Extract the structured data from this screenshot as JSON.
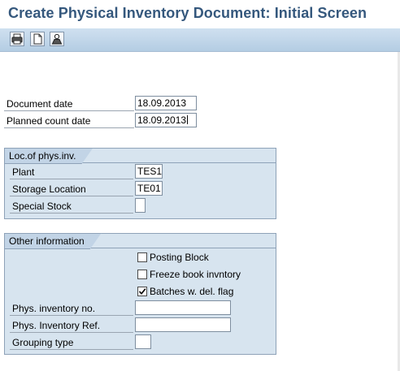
{
  "title": "Create Physical Inventory Document: Initial Screen",
  "toolbar": {
    "buttons": [
      {
        "icon": "print-icon"
      },
      {
        "icon": "new-document-icon"
      },
      {
        "icon": "profile-icon"
      }
    ]
  },
  "header": {
    "document_date": {
      "label": "Document date",
      "value": "18.09.2013"
    },
    "planned_count_date": {
      "label": "Planned count date",
      "value": "18.09.2013"
    }
  },
  "loc_group": {
    "title": "Loc.of phys.inv.",
    "plant": {
      "label": "Plant",
      "value": "TES1"
    },
    "storage_location": {
      "label": "Storage Location",
      "value": "TE01"
    },
    "special_stock": {
      "label": "Special Stock",
      "value": ""
    }
  },
  "other_group": {
    "title": "Other information",
    "posting_block": {
      "label": "Posting Block",
      "checked": false
    },
    "freeze_book": {
      "label": "Freeze book invntory",
      "checked": false
    },
    "batches_del_flag": {
      "label": "Batches w. del. flag",
      "checked": true
    },
    "phys_inventory_no": {
      "label": "Phys. inventory no.",
      "value": ""
    },
    "phys_inventory_ref": {
      "label": "Phys. Inventory Ref.",
      "value": ""
    },
    "grouping_type": {
      "label": "Grouping type",
      "value": ""
    }
  },
  "colors": {
    "title": "#35587d",
    "toolbar": "#c4d8ec",
    "group_bg": "#d7e4ef",
    "group_border": "#8ea2b8"
  }
}
